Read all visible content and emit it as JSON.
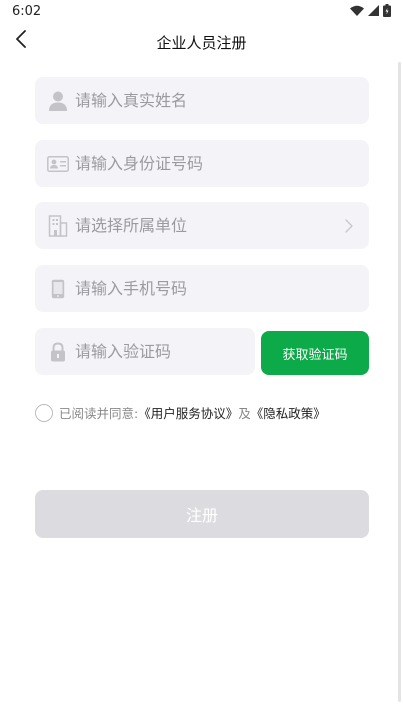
{
  "status_bar": {
    "time": "6:02"
  },
  "nav": {
    "title": "企业人员注册"
  },
  "form": {
    "name_placeholder": "请输入真实姓名",
    "id_placeholder": "请输入身份证号码",
    "org_placeholder": "请选择所属单位",
    "phone_placeholder": "请输入手机号码",
    "code_placeholder": "请输入验证码",
    "get_code_label": "获取验证码"
  },
  "agreement": {
    "prefix": "已阅读并同意:",
    "user_agreement": "《用户服务协议》",
    "and": " 及 ",
    "privacy_policy": "《隐私政策》",
    "checked": false
  },
  "register_label": "注册",
  "colors": {
    "accent": "#0daa4a",
    "field_bg": "#f4f4f8",
    "disabled_btn": "#dcdce0"
  }
}
